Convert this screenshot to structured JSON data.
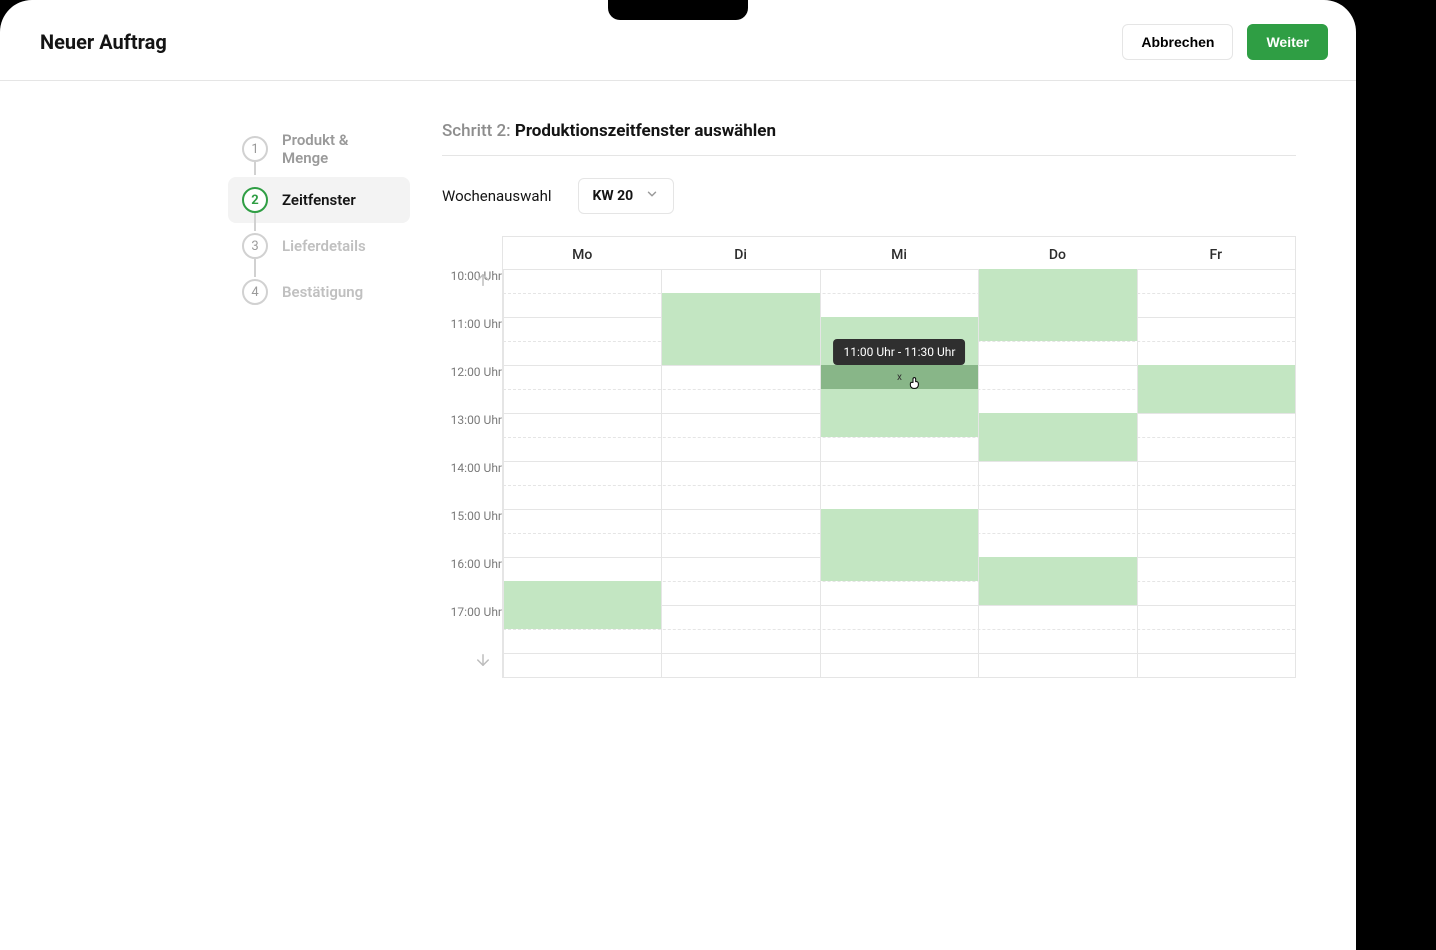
{
  "header": {
    "title": "Neuer Auftrag",
    "cancel_label": "Abbrechen",
    "continue_label": "Weiter"
  },
  "stepper": {
    "steps": [
      {
        "num": "1",
        "label": "Produkt & Menge",
        "state": "done"
      },
      {
        "num": "2",
        "label": "Zeitfenster",
        "state": "active"
      },
      {
        "num": "3",
        "label": "Lieferdetails",
        "state": "upcoming"
      },
      {
        "num": "4",
        "label": "Bestätigung",
        "state": "upcoming"
      }
    ]
  },
  "main": {
    "step_prefix": "Schritt 2:",
    "step_title": "Produktionszeitfenster auswählen",
    "week_label": "Wochenauswahl",
    "week_value": "KW 20"
  },
  "calendar": {
    "days": [
      "Mo",
      "Di",
      "Mi",
      "Do",
      "Fr"
    ],
    "visible_start_hour": 9,
    "hour_height": 48,
    "hours": [
      "10:00 Uhr",
      "11:00 Uhr",
      "12:00 Uhr",
      "13:00 Uhr",
      "14:00 Uhr",
      "15:00 Uhr",
      "16:00 Uhr",
      "17:00 Uhr"
    ],
    "slots": [
      {
        "day": 0,
        "start": 15.5,
        "end": 16.5
      },
      {
        "day": 1,
        "start": 9.5,
        "end": 11.0
      },
      {
        "day": 2,
        "start": 10.0,
        "end": 12.5
      },
      {
        "day": 2,
        "start": 14.0,
        "end": 15.5
      },
      {
        "day": 3,
        "start": 9.0,
        "end": 10.5
      },
      {
        "day": 3,
        "start": 12.0,
        "end": 13.0
      },
      {
        "day": 3,
        "start": 15.0,
        "end": 16.0
      },
      {
        "day": 4,
        "start": 11.0,
        "end": 12.0
      }
    ],
    "selected": {
      "day": 2,
      "start": 11.0,
      "end": 11.5,
      "close_label": "x"
    },
    "tooltip_text": "11:00 Uhr - 11:30 Uhr"
  },
  "colors": {
    "brand_green": "#2f9e44",
    "slot_green": "#c3e6c2"
  }
}
